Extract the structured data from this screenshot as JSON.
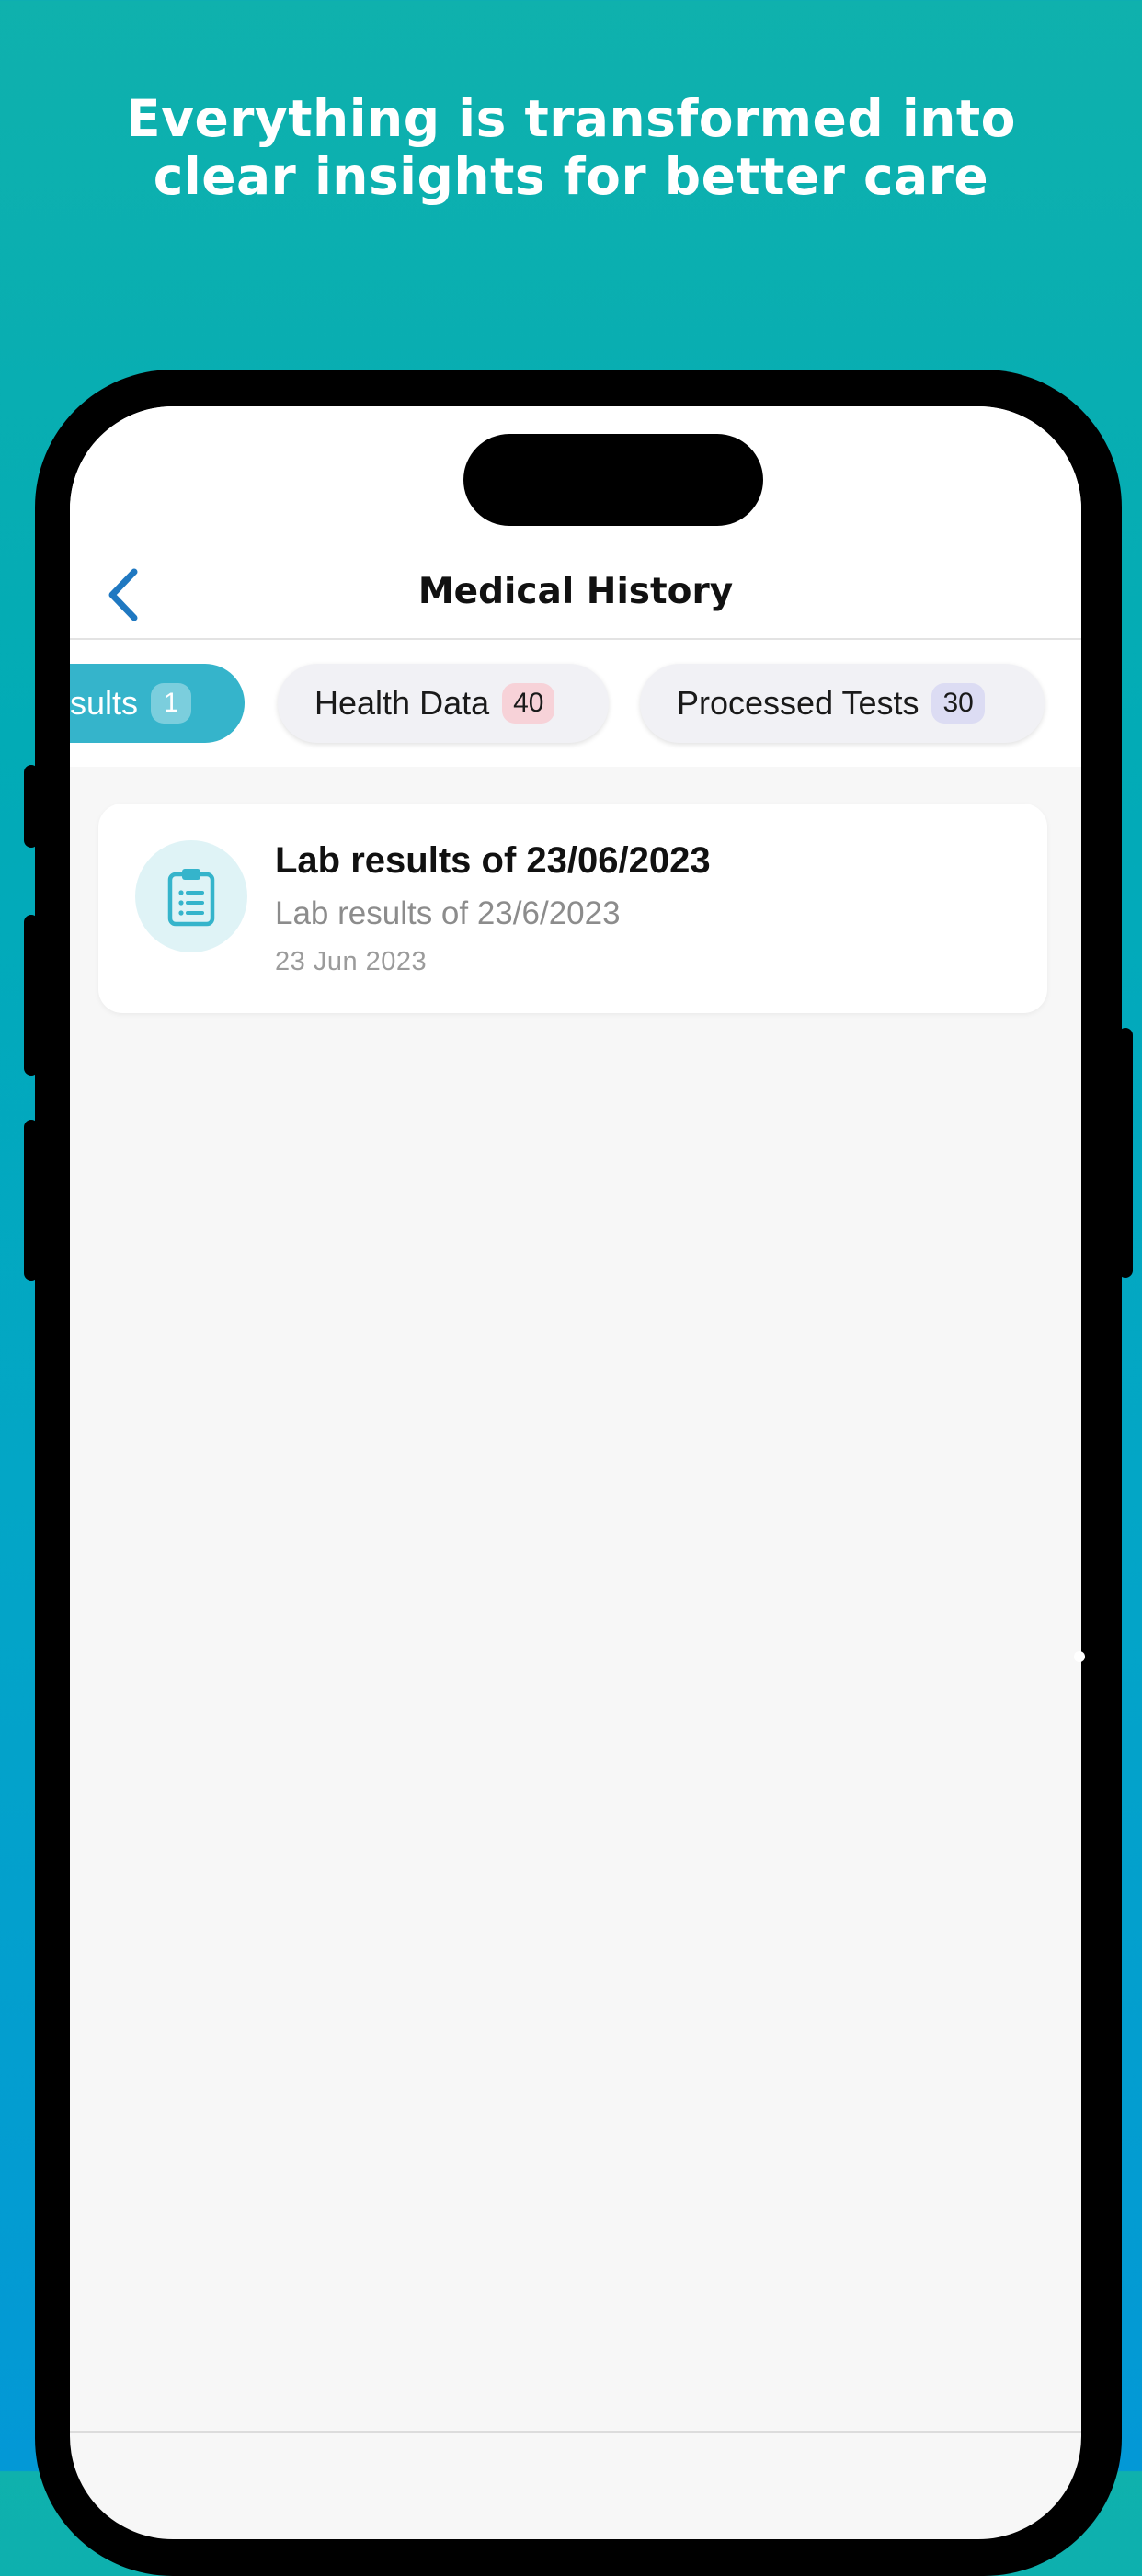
{
  "headline": {
    "line1": "Everything is transformed into",
    "line2": "clear insights for better care"
  },
  "navbar": {
    "title": "Medical History",
    "back_icon": "chevron-left-icon"
  },
  "tabs": [
    {
      "label": "esults",
      "count": "1",
      "active": true
    },
    {
      "label": "Health Data",
      "count": "40",
      "active": false
    },
    {
      "label": "Processed Tests",
      "count": "30",
      "active": false
    }
  ],
  "records": [
    {
      "icon": "clipboard-icon",
      "title": "Lab results of 23/06/2023",
      "subtitle": "Lab results of 23/6/2023",
      "date": "23 Jun 2023"
    }
  ],
  "colors": {
    "accent": "#35b4cb",
    "back_chevron": "#1f78c1",
    "badge_pink": "#f7d2d8",
    "badge_lavender": "#dcdcf3"
  }
}
